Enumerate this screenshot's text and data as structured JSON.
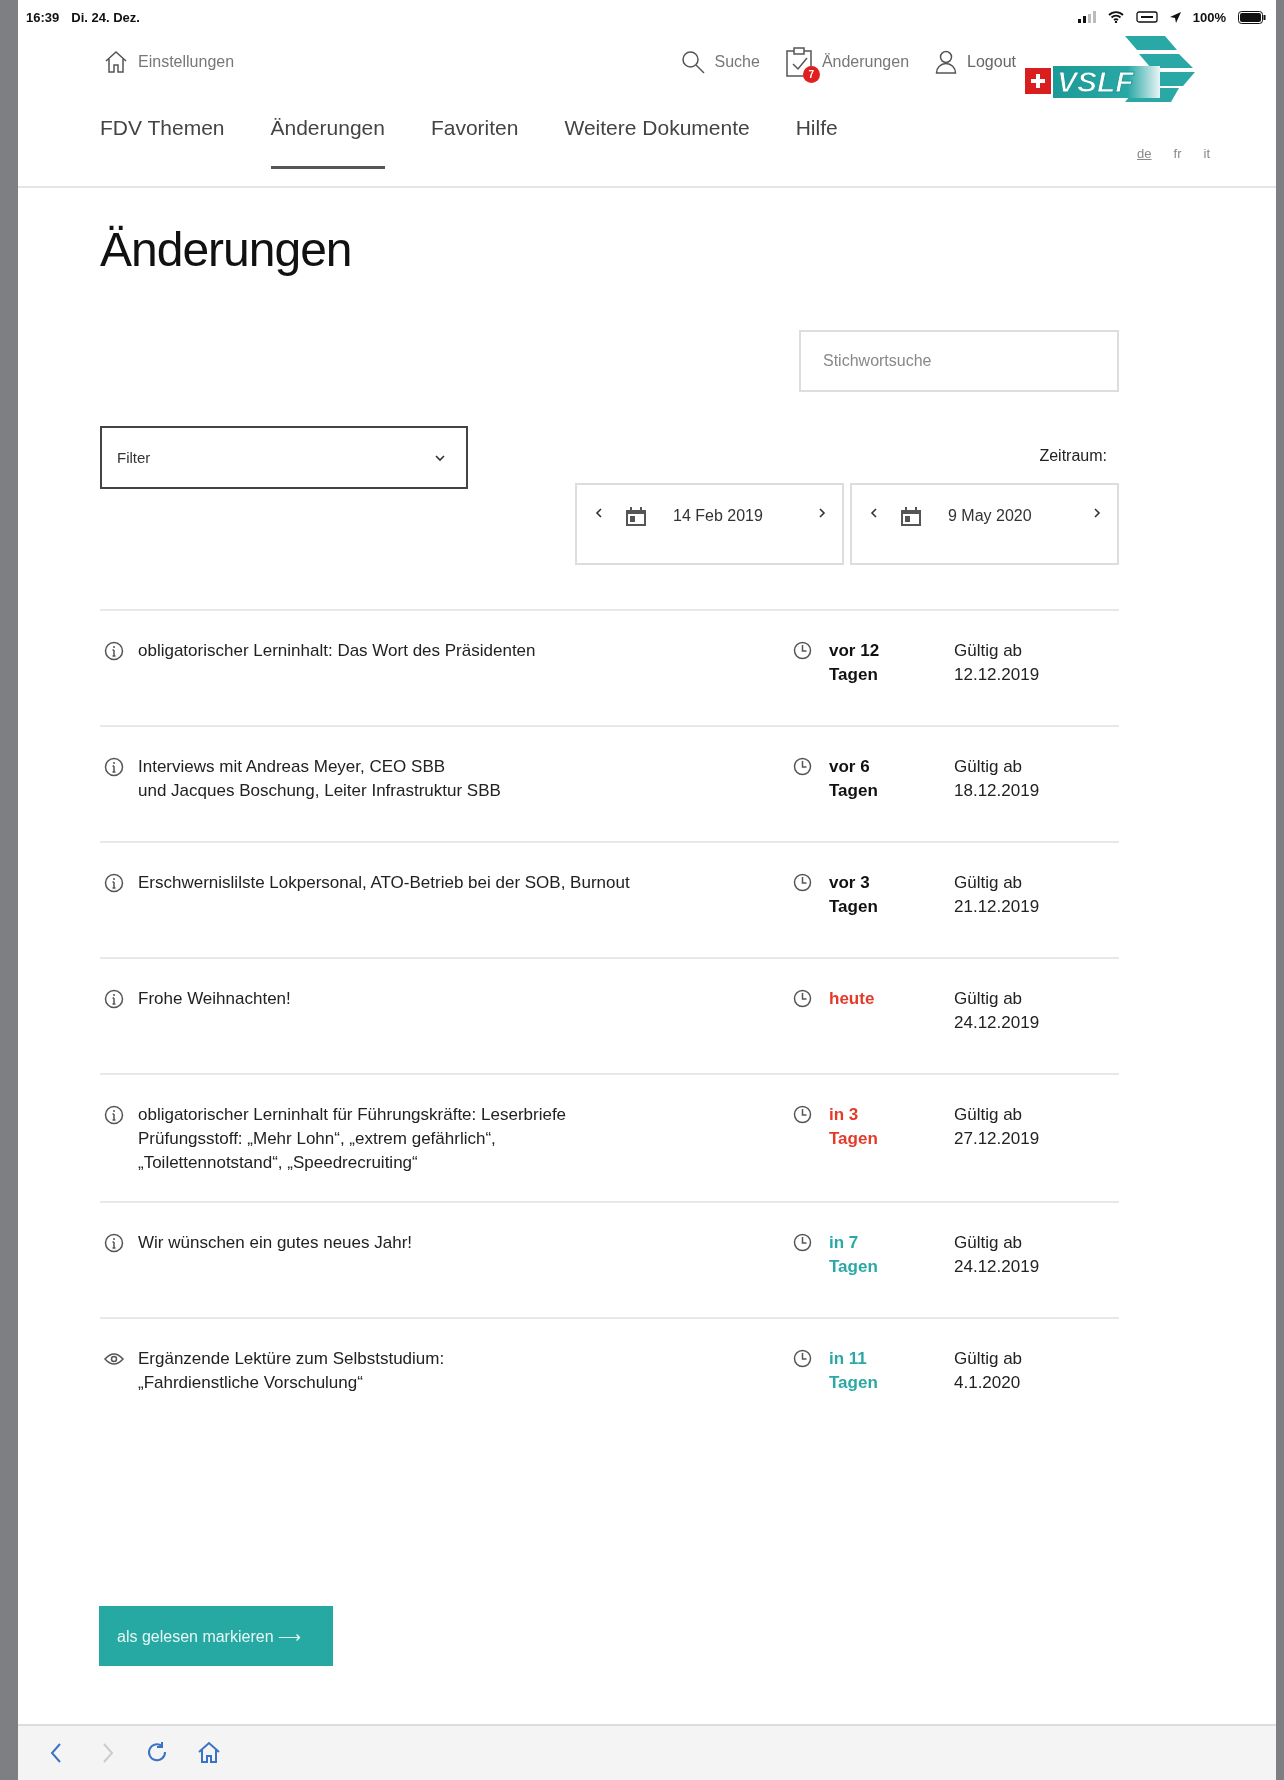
{
  "status_bar": {
    "time": "16:39",
    "date": "Di. 24. Dez.",
    "battery": "100%"
  },
  "header": {
    "settings": "Einstellungen",
    "search": "Suche",
    "changes": "Änderungen",
    "changes_badge": "7",
    "logout": "Logout",
    "logo_text": "VSLF"
  },
  "nav": [
    {
      "label": "FDV Themen",
      "selected": false
    },
    {
      "label": "Änderungen",
      "selected": true
    },
    {
      "label": "Favoriten",
      "selected": false
    },
    {
      "label": "Weitere Dokumente",
      "selected": false
    },
    {
      "label": "Hilfe",
      "selected": false
    }
  ],
  "languages": [
    {
      "label": "de",
      "selected": true
    },
    {
      "label": "fr",
      "selected": false
    },
    {
      "label": "it",
      "selected": false
    }
  ],
  "title": "Änderungen",
  "search": {
    "placeholder": "Stichwortsuche"
  },
  "filter": {
    "placeholder": "Filter"
  },
  "period": {
    "label": "Zeitraum:",
    "from": "14 Feb 2019",
    "to": "9 May 2020"
  },
  "changes": [
    {
      "kind": "info",
      "title": "obligatorischer Lerninhalt: Das Wort des Präsidenten",
      "when": "vor 12\nTagen",
      "color": "#111111",
      "valid_label": "Gültig ab",
      "valid_date": "12.12.2019"
    },
    {
      "kind": "info",
      "title": "Interviews mit Andreas Meyer, CEO SBB\nund Jacques Boschung, Leiter Infrastruktur SBB",
      "when": "vor 6\nTagen",
      "color": "#111111",
      "valid_label": "Gültig ab",
      "valid_date": "18.12.2019"
    },
    {
      "kind": "info",
      "title": "Erschwernislilste Lokpersonal, ATO-Betrieb bei der SOB, Burnout",
      "when": "vor 3\nTagen",
      "color": "#111111",
      "valid_label": "Gültig ab",
      "valid_date": "21.12.2019"
    },
    {
      "kind": "info",
      "title": "Frohe Weihnachten!",
      "when": "heute",
      "color": "#e53a2a",
      "valid_label": "Gültig ab",
      "valid_date": "24.12.2019"
    },
    {
      "kind": "info",
      "title": "obligatorischer Lerninhalt für Führungskräfte: Leserbriefe\nPrüfungsstoff: „Mehr Lohn“, „extrem gefährlich“,\n„Toilettennotstand“, „Speedrecruiting“",
      "when": "in 3\nTagen",
      "color": "#e53a2a",
      "valid_label": "Gültig ab",
      "valid_date": "27.12.2019"
    },
    {
      "kind": "info",
      "title": "Wir wünschen ein gutes neues Jahr!",
      "when": "in 7\nTagen",
      "color": "#2aa8a6",
      "valid_label": "Gültig ab",
      "valid_date": "24.12.2019"
    },
    {
      "kind": "eye",
      "title": "Ergänzende Lektüre zum Selbststudium:\n„Fahrdienstliche Vorschulung“",
      "when": "in 11\nTagen",
      "color": "#2aa8a6",
      "valid_label": "Gültig ab",
      "valid_date": "4.1.2020"
    }
  ],
  "mark_read_button": "als gelesen markieren ⟶",
  "browser_toolbar": [
    {
      "kind": "back",
      "disabled": false
    },
    {
      "kind": "forward",
      "disabled": true
    },
    {
      "kind": "reload",
      "disabled": false
    },
    {
      "kind": "home",
      "disabled": false
    }
  ]
}
